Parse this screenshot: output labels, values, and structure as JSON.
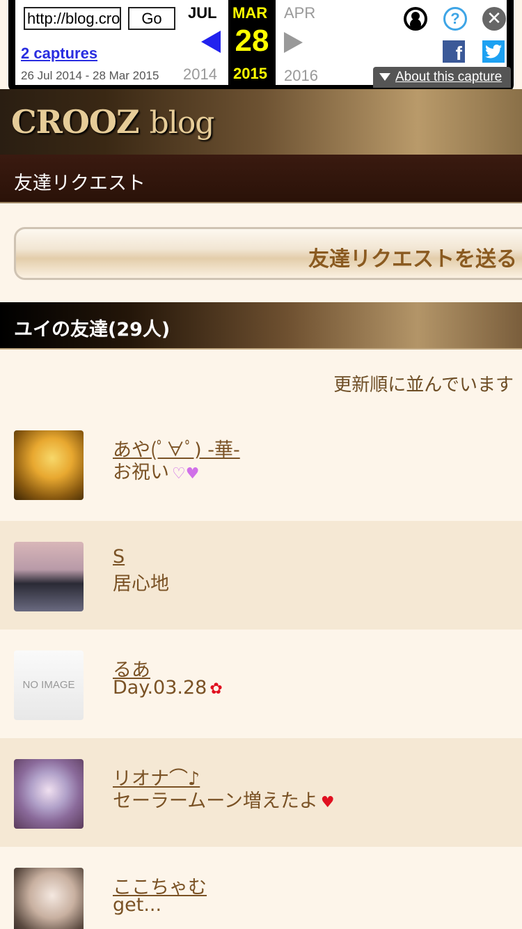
{
  "wayback": {
    "url_value": "http://blog.crooz.jp/",
    "go_label": "Go",
    "captures_link": "2 captures",
    "date_range": "26 Jul 2014 - 28 Mar 2015",
    "prev_month": "JUL",
    "prev_year": "2014",
    "current_month": "MAR",
    "current_day": "28",
    "current_year": "2015",
    "next_month": "APR",
    "next_year": "2016",
    "about_label": "About this capture",
    "help_glyph": "?",
    "close_glyph": "✕",
    "facebook_glyph": "f",
    "icons": [
      "user-icon",
      "help-icon",
      "close-icon",
      "facebook-icon",
      "twitter-icon"
    ]
  },
  "header": {
    "brand": "CROOZ",
    "brand_suffix": "blog"
  },
  "subbar": {
    "title": "友達リクエスト"
  },
  "request_button": {
    "label": "友達リクエストを送る"
  },
  "friends_section": {
    "title": "ユイの友達(29人)",
    "sort_note": "更新順に並んでいます"
  },
  "friends": [
    {
      "name": "あや(ﾟ∀ﾟ) -華-",
      "message": "お祝い",
      "emoji": "♡♥",
      "avatar": "photo-gold",
      "alt": false
    },
    {
      "name": "S",
      "message": "居心地",
      "emoji": "",
      "avatar": "photo-mask",
      "alt": true
    },
    {
      "name": "るあ",
      "message": "Day.03.28",
      "emoji": "✿",
      "avatar": "no-image",
      "alt": false
    },
    {
      "name": "リオナ⌒♪",
      "message": "セーラームーン増えたよ",
      "emoji": "♥",
      "avatar": "photo-blue-eyes",
      "alt": true
    },
    {
      "name": "ここちゃむ",
      "message": "get...",
      "emoji": "",
      "avatar": "photo-girl",
      "alt": false
    }
  ],
  "no_image_label": "NO IMAGE",
  "colors": {
    "background": "#fdf5ea",
    "alt_row": "#f5e8d4",
    "link_brown": "#7a5225",
    "wayback_highlight": "#ffff00",
    "wayback_arrow": "#2222ee"
  }
}
